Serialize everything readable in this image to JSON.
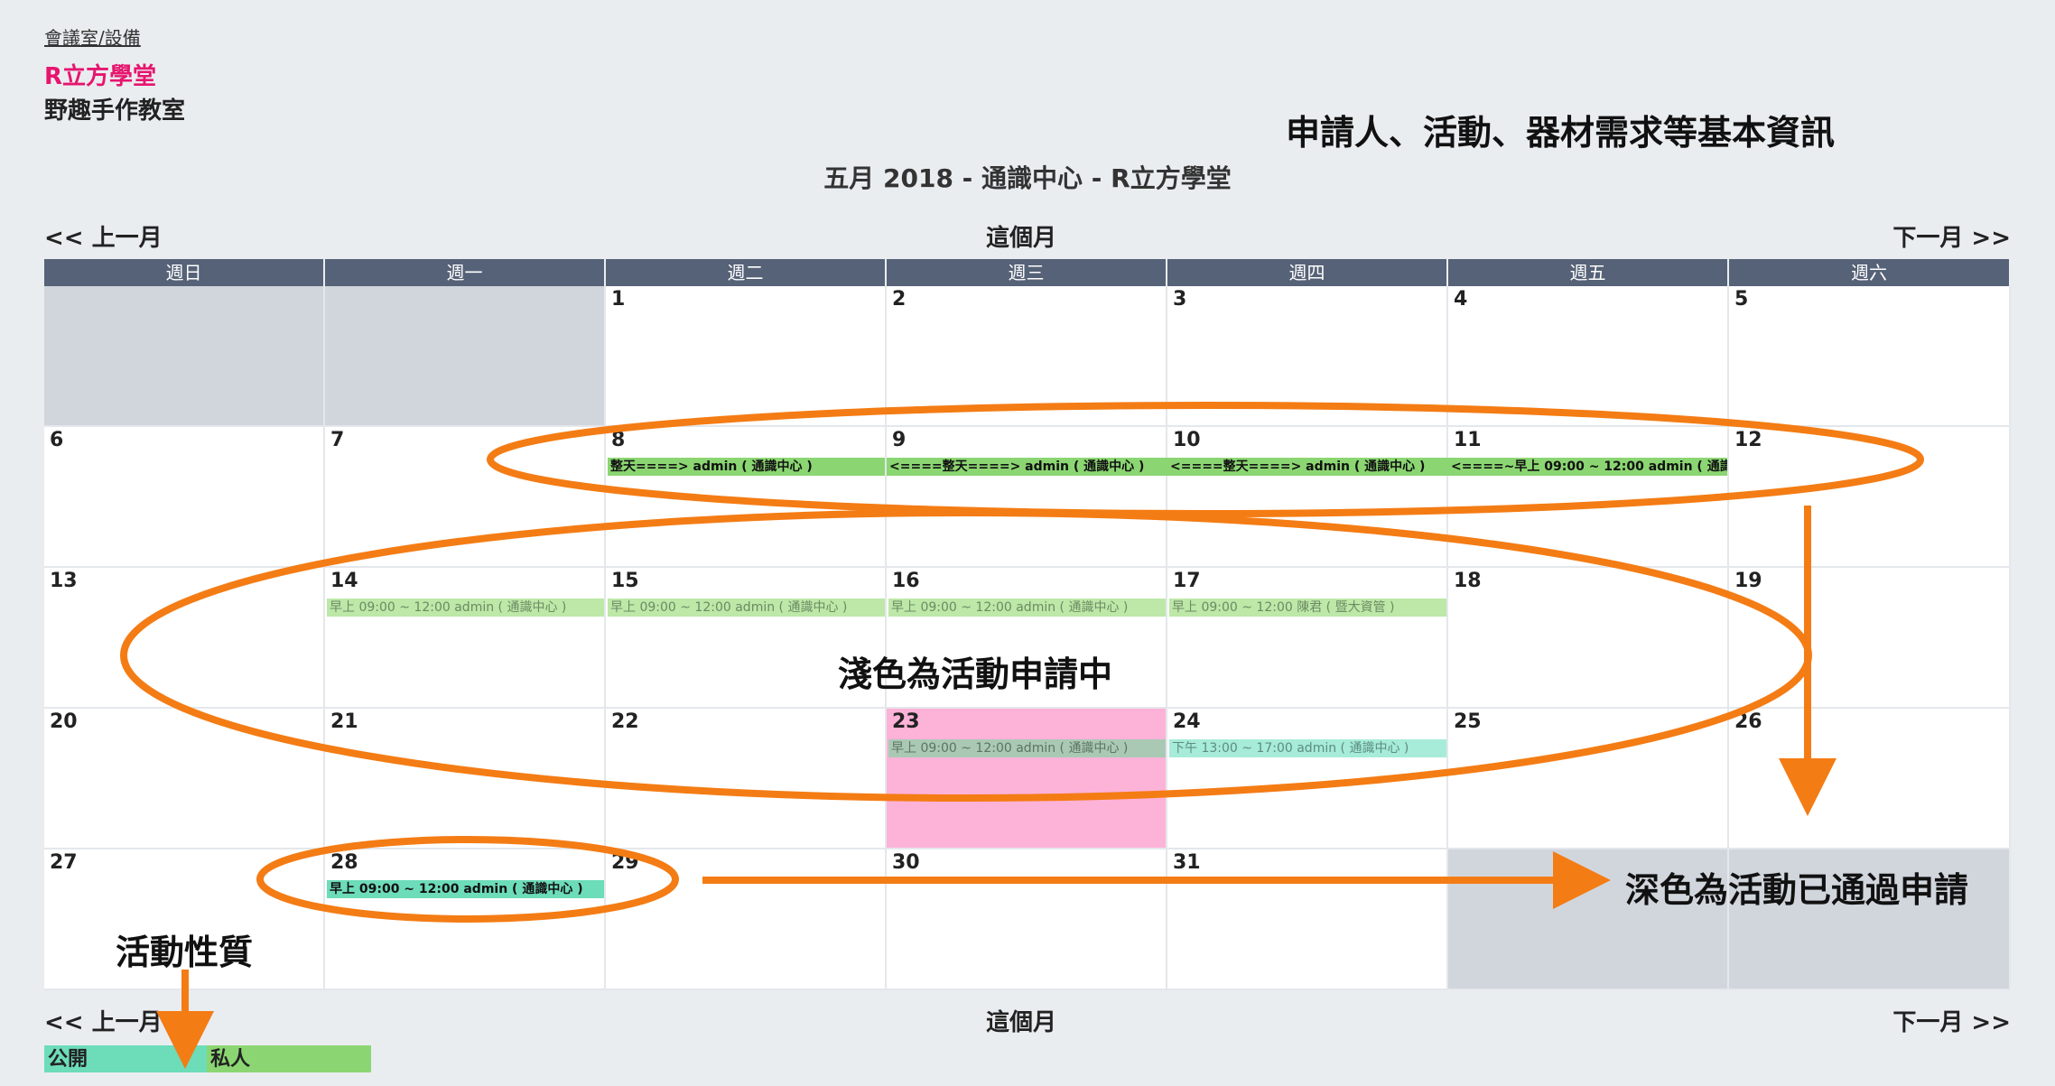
{
  "breadcrumb": "會議室/設備",
  "room": {
    "name": "R立方學堂",
    "subtitle": "野趣手作教室"
  },
  "calendar": {
    "title": "五月 2018 - 通識中心 - R立方學堂",
    "nav": {
      "prev": "<< 上一月",
      "current": "這個月",
      "next": "下一月 >>"
    },
    "weekdays": [
      "週日",
      "週一",
      "週二",
      "週三",
      "週四",
      "週五",
      "週六"
    ],
    "days": [
      "",
      "",
      "1",
      "2",
      "3",
      "4",
      "5",
      "6",
      "7",
      "8",
      "9",
      "10",
      "11",
      "12",
      "13",
      "14",
      "15",
      "16",
      "17",
      "18",
      "19",
      "20",
      "21",
      "22",
      "23",
      "24",
      "25",
      "26",
      "27",
      "28",
      "29",
      "30",
      "31",
      "",
      ""
    ],
    "events": {
      "may8": "整天====> admin ( 通識中心 )",
      "may9": "<====整天====> admin ( 通識中心 )",
      "may10": "<====整天====> admin ( 通識中心 )",
      "may11": "<====~早上 09:00 ~ 12:00 admin ( 通識中",
      "may14": "早上 09:00 ~ 12:00 admin ( 通識中心 )",
      "may15": "早上 09:00 ~ 12:00 admin ( 通識中心 )",
      "may16": "早上 09:00 ~ 12:00 admin ( 通識中心 )",
      "may17": "早上 09:00 ~ 12:00 陳君 ( 暨大資管 )",
      "may23": "早上 09:00 ~ 12:00 admin ( 通識中心 )",
      "may24": "下午 13:00 ~ 17:00 admin ( 通識中心 )",
      "may28": "早上 09:00 ~ 12:00 admin ( 通識中心 )"
    }
  },
  "legend": {
    "public": "公開",
    "private": "私人"
  },
  "annotations": {
    "info": "申請人、活動、器材需求等基本資訊",
    "pending": "淺色為活動申請中",
    "approved": "深色為活動已通過申請",
    "nature": "活動性質"
  },
  "colors": {
    "accent": "#e6156e",
    "header": "#566277",
    "approved": "#8bd672",
    "pending": "#bde8a8",
    "public": "#6ddcb9",
    "today": "#fdb2d8",
    "annotation": "#f47c14"
  }
}
